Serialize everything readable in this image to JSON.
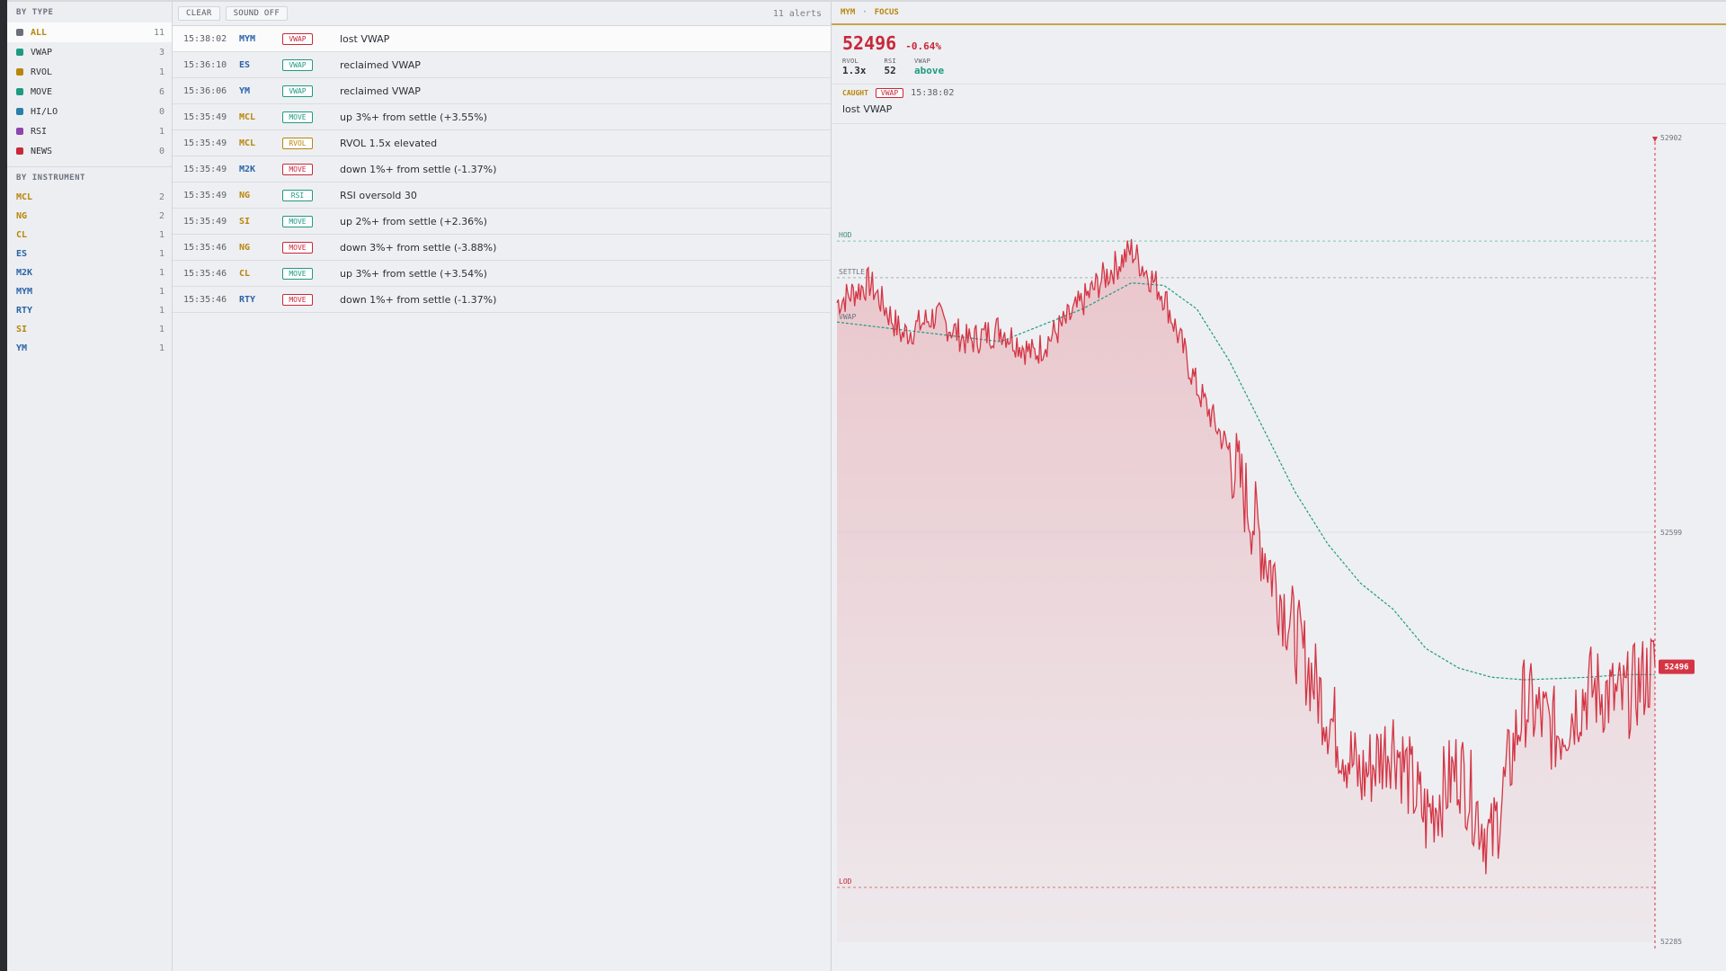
{
  "sidebar": {
    "by_type_title": "BY TYPE",
    "types": [
      {
        "label": "ALL",
        "count": "11",
        "color": "#6b6f78",
        "active": true
      },
      {
        "label": "VWAP",
        "count": "3",
        "color": "#1e9a82"
      },
      {
        "label": "RVOL",
        "count": "1",
        "color": "#b8860b"
      },
      {
        "label": "MOVE",
        "count": "6",
        "color": "#1e9a82"
      },
      {
        "label": "HI/LO",
        "count": "0",
        "color": "#2a7fa8"
      },
      {
        "label": "RSI",
        "count": "1",
        "color": "#8e44ad"
      },
      {
        "label": "NEWS",
        "count": "0",
        "color": "#c8283a"
      }
    ],
    "by_instrument_title": "BY INSTRUMENT",
    "instruments": [
      {
        "label": "MCL",
        "count": "2",
        "color": "#b8860b"
      },
      {
        "label": "NG",
        "count": "2",
        "color": "#b8860b"
      },
      {
        "label": "CL",
        "count": "1",
        "color": "#b8860b"
      },
      {
        "label": "ES",
        "count": "1",
        "color": "#2a63a8"
      },
      {
        "label": "M2K",
        "count": "1",
        "color": "#2a63a8"
      },
      {
        "label": "MYM",
        "count": "1",
        "color": "#2a63a8"
      },
      {
        "label": "RTY",
        "count": "1",
        "color": "#2a63a8"
      },
      {
        "label": "SI",
        "count": "1",
        "color": "#b8860b"
      },
      {
        "label": "YM",
        "count": "1",
        "color": "#2a63a8"
      }
    ]
  },
  "toolbar": {
    "clear_label": "CLEAR",
    "sound_label": "SOUND OFF",
    "alert_count": "11 alerts"
  },
  "alerts": [
    {
      "time": "15:38:02",
      "sym": "MYM",
      "sym_color": "#2a63a8",
      "tag": "VWAP",
      "tag_color": "#c8283a",
      "msg": "lost VWAP",
      "selected": true
    },
    {
      "time": "15:36:10",
      "sym": "ES",
      "sym_color": "#2a63a8",
      "tag": "VWAP",
      "tag_color": "#1e9a82",
      "msg": "reclaimed VWAP"
    },
    {
      "time": "15:36:06",
      "sym": "YM",
      "sym_color": "#2a63a8",
      "tag": "VWAP",
      "tag_color": "#1e9a82",
      "msg": "reclaimed VWAP"
    },
    {
      "time": "15:35:49",
      "sym": "MCL",
      "sym_color": "#b8860b",
      "tag": "MOVE",
      "tag_color": "#1e9a82",
      "msg": "up 3%+ from settle (+3.55%)"
    },
    {
      "time": "15:35:49",
      "sym": "MCL",
      "sym_color": "#b8860b",
      "tag": "RVOL",
      "tag_color": "#b8860b",
      "msg": "RVOL 1.5x elevated"
    },
    {
      "time": "15:35:49",
      "sym": "M2K",
      "sym_color": "#2a63a8",
      "tag": "MOVE",
      "tag_color": "#c8283a",
      "msg": "down 1%+ from settle (-1.37%)"
    },
    {
      "time": "15:35:49",
      "sym": "NG",
      "sym_color": "#b8860b",
      "tag": "RSI",
      "tag_color": "#1e9a82",
      "msg": "RSI oversold 30"
    },
    {
      "time": "15:35:49",
      "sym": "SI",
      "sym_color": "#b8860b",
      "tag": "MOVE",
      "tag_color": "#1e9a82",
      "msg": "up 2%+ from settle (+2.36%)"
    },
    {
      "time": "15:35:46",
      "sym": "NG",
      "sym_color": "#b8860b",
      "tag": "MOVE",
      "tag_color": "#c8283a",
      "msg": "down 3%+ from settle (-3.88%)"
    },
    {
      "time": "15:35:46",
      "sym": "CL",
      "sym_color": "#b8860b",
      "tag": "MOVE",
      "tag_color": "#1e9a82",
      "msg": "up 3%+ from settle (+3.54%)"
    },
    {
      "time": "15:35:46",
      "sym": "RTY",
      "sym_color": "#2a63a8",
      "tag": "MOVE",
      "tag_color": "#c8283a",
      "msg": "down 1%+ from settle (-1.37%)"
    }
  ],
  "focus": {
    "symbol": "MYM",
    "separator": "·",
    "mode": "FOCUS",
    "price": "52496",
    "change": "-0.64%",
    "metrics": {
      "rvol_label": "RVOL",
      "rvol_value": "1.3x",
      "rsi_label": "RSI",
      "rsi_value": "52",
      "vwap_label": "VWAP",
      "vwap_value": "above"
    },
    "caught_label": "CAUGHT",
    "caught_tag": "VWAP",
    "caught_time": "15:38:02",
    "caught_msg": "lost VWAP"
  },
  "colors": {
    "price_line": "#d43545",
    "vwap_line": "#1e9a82",
    "area_fill": "#e8b8be",
    "hod_line": "#7fc5b8",
    "settle_line": "#a8acb2",
    "lod_line": "#e07080",
    "current_marker": "#d43545"
  },
  "chart_data": {
    "type": "line",
    "ylim": [
      52285,
      52902
    ],
    "y_axis_labels": [
      "52902",
      "52599",
      "52285"
    ],
    "levels": {
      "hod_label": "HOD",
      "hod": 52822,
      "settle_label": "SETTLE",
      "settle": 52794,
      "vwap_label": "VWAP",
      "lod_label": "LOD",
      "lod": 52327
    },
    "current_value": "52496",
    "price": {
      "x": [
        0,
        4,
        8,
        12,
        16,
        20,
        24,
        28,
        32,
        36,
        40,
        44,
        48,
        52,
        56,
        60,
        64,
        68,
        72,
        76,
        80,
        84,
        88,
        92,
        96,
        100
      ],
      "y": [
        52775,
        52790,
        52750,
        52765,
        52745,
        52755,
        52735,
        52760,
        52790,
        52815,
        52780,
        52710,
        52660,
        52590,
        52520,
        52460,
        52410,
        52440,
        52380,
        52420,
        52360,
        52470,
        52445,
        52480,
        52470,
        52496
      ]
    },
    "vwap": {
      "x": [
        0,
        20,
        30,
        36,
        40,
        44,
        48,
        52,
        56,
        60,
        64,
        68,
        72,
        76,
        80,
        84,
        88,
        92,
        96,
        100
      ],
      "y": [
        52760,
        52745,
        52770,
        52790,
        52788,
        52770,
        52730,
        52680,
        52630,
        52590,
        52560,
        52540,
        52510,
        52495,
        52488,
        52486,
        52487,
        52488,
        52490,
        52490
      ]
    }
  }
}
